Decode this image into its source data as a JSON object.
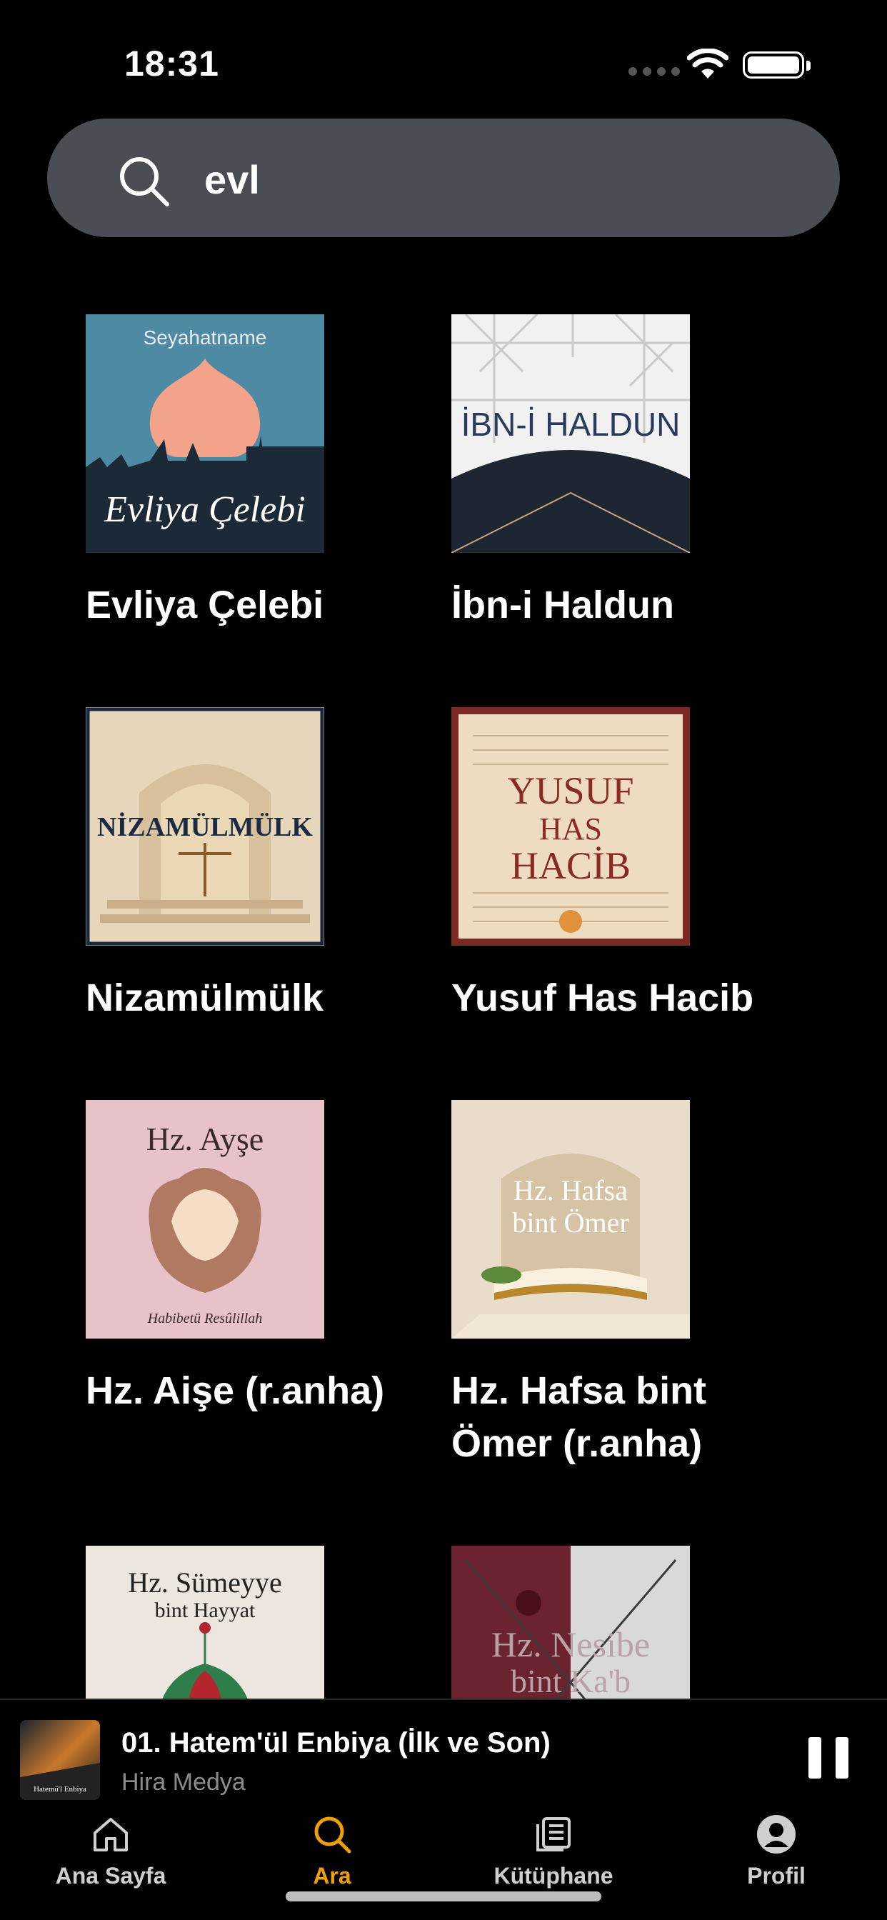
{
  "status_bar": {
    "time": "18:31"
  },
  "search": {
    "value": "evl",
    "placeholder": ""
  },
  "results": [
    {
      "title": "Evliya Çelebi",
      "cover_text_top": "Seyahatname",
      "cover_text": "Evliya Çelebi"
    },
    {
      "title": "İbn-i Haldun",
      "cover_text": "İBN-İ HALDUN"
    },
    {
      "title": "Nizamülmülk",
      "cover_text": "NİZAMÜLMÜLK"
    },
    {
      "title": "Yusuf Has Hacib",
      "cover_text_lines": [
        "YUSUF",
        "HAS",
        "HACİB"
      ]
    },
    {
      "title": "Hz. Aişe (r.anha)",
      "cover_text_top": "Hz. Ayşe",
      "cover_text_bottom": "Habibetü Resûlillah"
    },
    {
      "title": "Hz. Hafsa bint Ömer (r.anha)",
      "cover_text_lines": [
        "Hz. Hafsa",
        "bint Ömer"
      ]
    },
    {
      "title": "",
      "cover_text_lines": [
        "Hz. Sümeyye",
        "bint Hayyat"
      ]
    },
    {
      "title": "",
      "cover_text_lines": [
        "Hz. Nesibe",
        "bint Ka'b"
      ]
    }
  ],
  "mini_player": {
    "title": "01. Hatem'ül Enbiya (İlk ve Son)",
    "artist": "Hira Medya",
    "art_text": "Hatemü'l Enbiya"
  },
  "tabs": [
    {
      "label": "Ana Sayfa",
      "icon": "home-icon",
      "active": false
    },
    {
      "label": "Ara",
      "icon": "search-icon",
      "active": true
    },
    {
      "label": "Kütüphane",
      "icon": "library-icon",
      "active": false
    },
    {
      "label": "Profil",
      "icon": "profile-icon",
      "active": false
    }
  ],
  "colors": {
    "accent": "#f0a000",
    "search_bg": "#4a4d53",
    "background": "#000000"
  }
}
